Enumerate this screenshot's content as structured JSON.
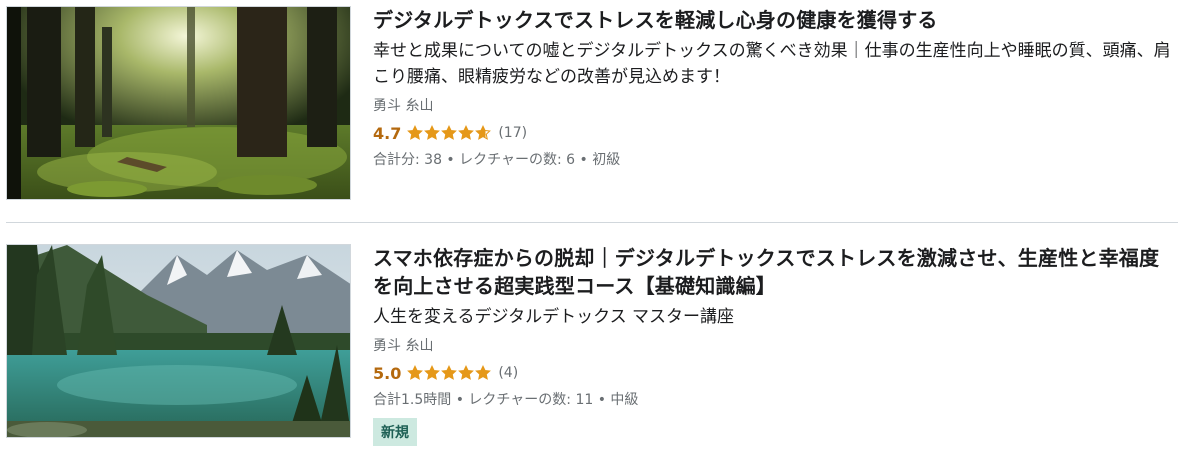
{
  "courses": [
    {
      "title": "デジタルデトックスでストレスを軽減し心身の健康を獲得する",
      "headline": "幸せと成果についての嘘とデジタルデトックスの驚くべき効果｜仕事の生産性向上や睡眠の質、頭痛、肩こり腰痛、眼精疲労などの改善が見込めます！",
      "author": "勇斗 糸山",
      "rating": "4.7",
      "rating_value": 4.7,
      "review_count": "(17)",
      "meta": "合計分: 38 • レクチャーの数: 6 • 初級",
      "thumbnail": "forest-image"
    },
    {
      "title": "スマホ依存症からの脱却｜デジタルデトックスでストレスを激減させ、生産性と幸福度を向上させる超実践型コース【基礎知識編】",
      "headline": "人生を変えるデジタルデトックス マスター講座",
      "author": "勇斗 糸山",
      "rating": "5.0",
      "rating_value": 5.0,
      "review_count": "(4)",
      "meta": "合計1.5時間 • レクチャーの数: 11 • 中級",
      "badge": "新規",
      "thumbnail": "mountain-lake-image"
    }
  ],
  "colors": {
    "rating": "#b4690e",
    "star": "#e59819",
    "muted": "#6a6f73",
    "badge_bg": "#cde9e0",
    "badge_text": "#1e6055"
  }
}
